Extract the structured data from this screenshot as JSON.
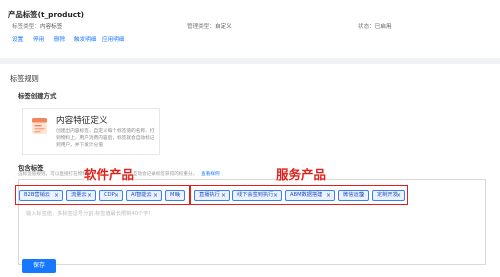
{
  "product": {
    "title": "产品标签(t_product)",
    "fields": [
      {
        "key": "标签类型：",
        "value": "内容标签"
      },
      {
        "key": "管理类型：",
        "value": "自定义"
      },
      {
        "key": "状态：",
        "value": "已启用"
      }
    ],
    "actions": [
      "设置",
      "停用",
      "删除",
      "触发明细",
      "应用明细"
    ]
  },
  "rules": {
    "section_title": "标签规则",
    "create_method_title": "标签创建方式",
    "option": {
      "name": "内容特征定义",
      "description": "创建出内容标签，自定义每个标签值的名称、打到物料上，用户消费内容后，标签就会自动标记到用户，并下发计分值"
    },
    "include_title": "包含标签",
    "include_desc": "选标签值规则，可以直接打在物料、内容上，用户与物料互动会记录标签获得的权重分。",
    "include_more": "查看样例",
    "tags": [
      {
        "label": "B2B营销云"
      },
      {
        "label": "流量云"
      },
      {
        "label": "CDP"
      },
      {
        "label": "AI智能云"
      },
      {
        "label": "MIP"
      },
      {
        "label": "直播执行"
      },
      {
        "label": "线下会签到执行"
      },
      {
        "label": "ABM数据搭建"
      },
      {
        "label": "微信运营"
      },
      {
        "label": "定制开发"
      }
    ],
    "tag_close_glyph": "×",
    "input_placeholder": "输入标签值，多标签逗号分割,标签值最长限制40个字!",
    "save_label": "保存"
  },
  "annotations": {
    "software_label": "软件产品",
    "service_label": "服务产品",
    "highlight_color": "#e0201a"
  }
}
